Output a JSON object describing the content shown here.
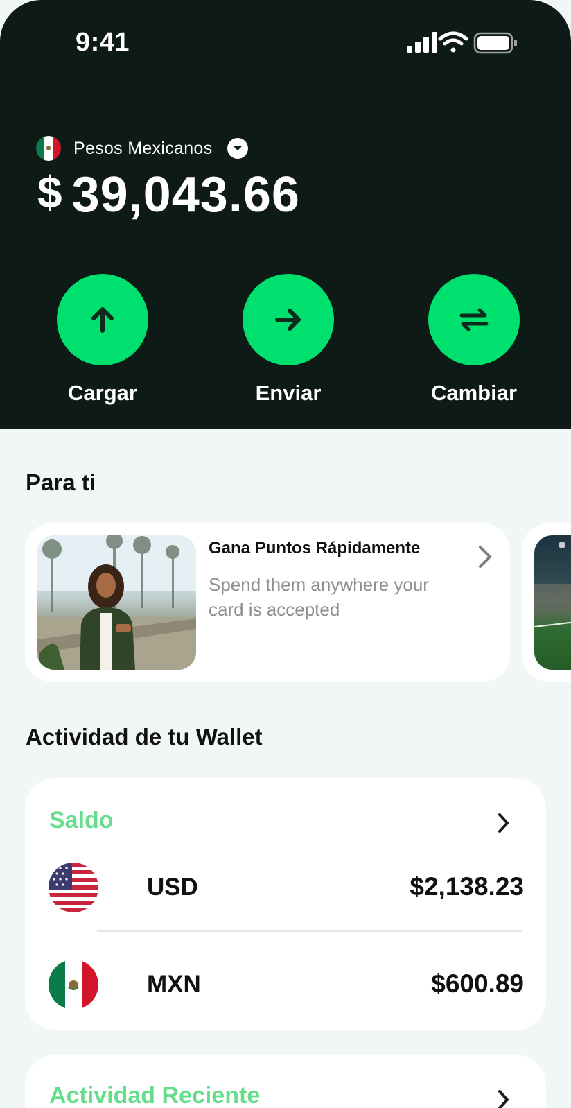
{
  "status_bar": {
    "time": "9:41"
  },
  "wallet_header": {
    "currency_name": "Pesos Mexicanos",
    "currency_symbol": "$",
    "balance": "39,043.66"
  },
  "actions": [
    {
      "label": "Cargar",
      "icon": "arrow-up-icon"
    },
    {
      "label": "Enviar",
      "icon": "arrow-right-icon"
    },
    {
      "label": "Cambiar",
      "icon": "swap-arrows-icon"
    }
  ],
  "for_you": {
    "title": "Para ti",
    "promo": {
      "title": "Gana Puntos Rápidamente",
      "description": "Spend them anywhere your card is accepted"
    }
  },
  "wallet_activity": {
    "title": "Actividad de tu Wallet",
    "balance_card": {
      "heading": "Saldo",
      "rows": [
        {
          "code": "USD",
          "amount": "$2,138.23",
          "flag": "us-flag"
        },
        {
          "code": "MXN",
          "amount": "$600.89",
          "flag": "mx-flag"
        }
      ]
    },
    "recent_card": {
      "heading": "Actividad Reciente"
    }
  },
  "colors": {
    "hero_bg": "#0d1a16",
    "accent": "#00e06e",
    "accent_text": "#66dd8c",
    "page_bg": "#f1f6f6"
  }
}
